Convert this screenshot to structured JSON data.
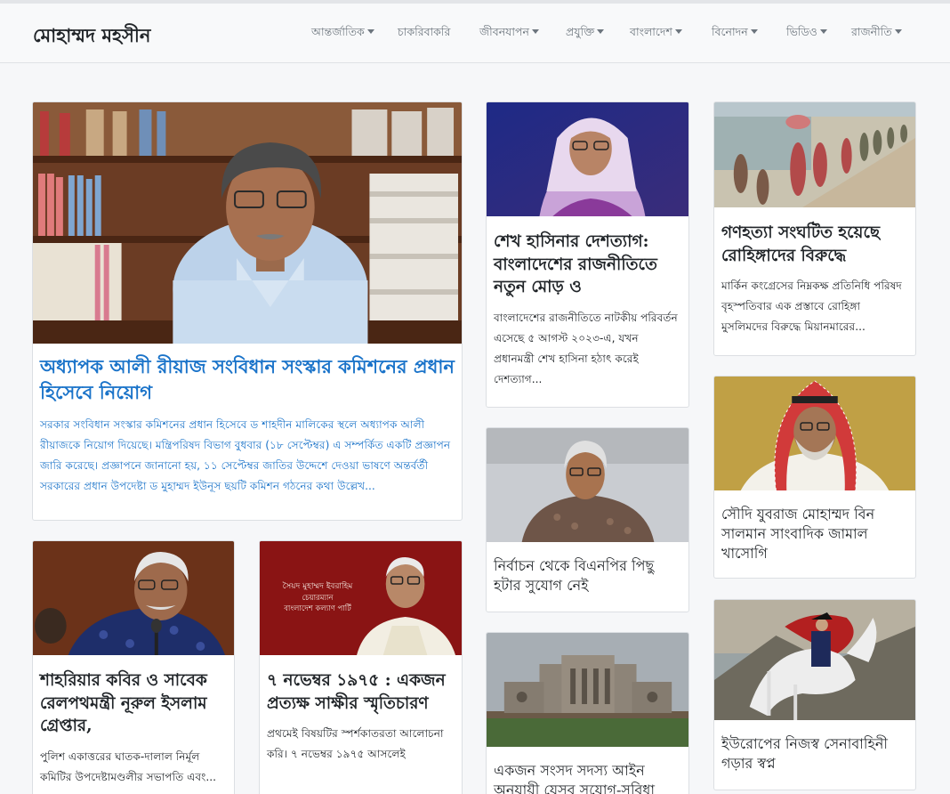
{
  "brand": "মোহাম্মদ মহসীন",
  "nav": [
    {
      "label": "আন্তর্জাতিক",
      "dropdown": true
    },
    {
      "label": "চাকরিবাকরি",
      "dropdown": false
    },
    {
      "label": "জীবনযাপন",
      "dropdown": true
    },
    {
      "label": "প্রযুক্তি",
      "dropdown": true
    },
    {
      "label": "বাংলাদেশ",
      "dropdown": true
    },
    {
      "label": "বিনোদন",
      "dropdown": true
    },
    {
      "label": "ভিডিও",
      "dropdown": true
    },
    {
      "label": "রাজনীতি",
      "dropdown": true
    }
  ],
  "featured": {
    "title": "অধ্যাপক আলী রীয়াজ সংবিধান সংস্কার কমিশনের প্রধান হিসেবে নিয়োগ",
    "excerpt": "সরকার সংবিধান সংস্কার কমিশনের প্রধান হিসেবে ড শাহদীন মালিকের স্থলে অধ্যাপক আলী রীয়াজকে নিয়োগ দিয়েছে। মন্ত্রিপরিষদ বিভাগ বুধবার (১৮ সেপ্টেম্বর) এ সম্পর্কিত একটি প্রজ্ঞাপন জারি করেছে। প্রজ্ঞাপনে জানানো হয়, ১১ সেপ্টেম্বর জাতির উদ্দেশে দেওয়া ভাষণে অন্তর্বর্তী সরকারের প্রধান উপদেষ্টা ড মুহাম্মদ ইউনূস ছয়টি কমিশন গঠনের কথা উল্লেখ..."
  },
  "cards": {
    "hasina": {
      "title": "শেখ হাসিনার দেশত্যাগ: বাংলাদেশের রাজনীতিতে নতুন মোড় ও",
      "excerpt": "বাংলাদেশের রাজনীতিতে নাটকীয় পরিবর্তন এসেছে ৫ আগস্ট ২০২৩-এ, যখন প্রধানমন্ত্রী শেখ হাসিনা হঠাৎ করেই দেশত্যাগ..."
    },
    "rohingya": {
      "title": "গণহত্যা সংঘটিত হয়েছে রোহিঙ্গাদের বিরুদ্ধে",
      "excerpt": "মার্কিন কংগ্রেসের নিম্নকক্ষ প্রতিনিধি পরিষদ বৃহস্পতিবার এক প্রস্তাবে রোহিঙ্গা মুসলিমদের বিরুদ্ধে মিয়ানমারের..."
    },
    "bnp": {
      "title": "নির্বাচন থেকে বিএনপির পিছু হটার সুযোগ নেই"
    },
    "khashoggi": {
      "title": "সৌদি যুবরাজ মোহাম্মদ বিন সালমান সাংবাদিক জামাল খাসোগি"
    },
    "shahriar": {
      "title": "শাহরিয়ার কবির ও সাবেক রেলপথমন্ত্রী নূরুল ইসলাম গ্রেপ্তার,",
      "excerpt": "পুলিশ একাত্তরের ঘাতক-দালাল নির্মূল কমিটির উপদেষ্টামণ্ডলীর সভাপতি এবং..."
    },
    "november": {
      "title": "৭ নভেম্বর ১৯৭৫ : একজন প্রত্যক্ষ সাক্ষীর স্মৃতিচারণ",
      "excerpt": "প্রথমেই বিষয়টির স্পর্শকাতরতা আলোচনা করি। ৭ নভেম্বর ১৯৭৫ আসলেই",
      "image_caption": [
        "সৈয়দ মুহাম্মদ ইবরাহিম",
        "চেয়ারম্যান",
        "বাংলাদেশ কল্যাণ পার্টি"
      ]
    },
    "parliament": {
      "title": "একজন সংসদ সদস্য আইন অনুযায়ী যেসব সুযোগ-সুবিধা"
    },
    "europe": {
      "title": "ইউরোপের নিজস্ব সেনাবাহিনী গড়ার স্বপ্ন"
    }
  }
}
